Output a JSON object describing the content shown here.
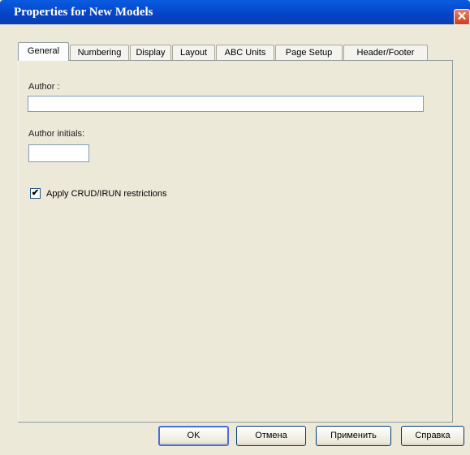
{
  "window": {
    "title": "Properties for New Models",
    "close_glyph": "✕"
  },
  "tabs": [
    {
      "label": "General",
      "active": true
    },
    {
      "label": "Numbering"
    },
    {
      "label": "Display"
    },
    {
      "label": "Layout"
    },
    {
      "label": "ABC Units"
    },
    {
      "label": "Page Setup"
    },
    {
      "label": "Header/Footer"
    }
  ],
  "form": {
    "author_label": "Author :",
    "author_value": "",
    "initials_label": "Author initials:",
    "initials_value": "",
    "crud_checked": true,
    "crud_check_glyph": "✔",
    "crud_label": "Apply CRUD/IRUN restrictions"
  },
  "buttons": {
    "ok": "OK",
    "cancel": "Отмена",
    "apply": "Применить",
    "help": "Справка"
  },
  "colors": {
    "titlebar": "#0543c7",
    "dialog_bg": "#ece9d8"
  }
}
